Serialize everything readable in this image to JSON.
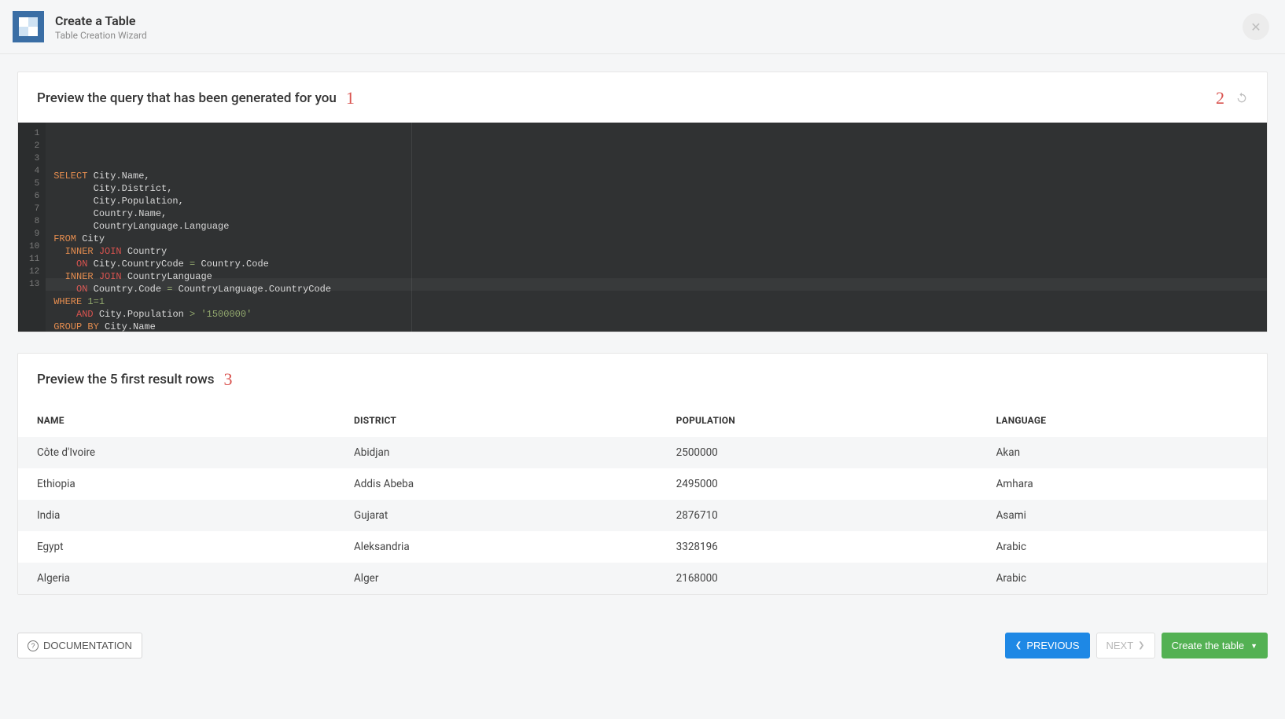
{
  "header": {
    "title": "Create a Table",
    "subtitle": "Table Creation Wizard"
  },
  "queryPanel": {
    "heading": "Preview the query that has been generated for you",
    "callout": "1",
    "refreshCallout": "2",
    "code": {
      "lineCount": 13,
      "tokens": [
        [
          {
            "c": "kw",
            "t": "SELECT"
          },
          {
            "c": "id",
            "t": " City.Name,"
          }
        ],
        [
          {
            "c": "id",
            "t": "       City.District,"
          }
        ],
        [
          {
            "c": "id",
            "t": "       City.Population,"
          }
        ],
        [
          {
            "c": "id",
            "t": "       Country.Name,"
          }
        ],
        [
          {
            "c": "id",
            "t": "       CountryLanguage.Language"
          }
        ],
        [
          {
            "c": "kw",
            "t": "FROM"
          },
          {
            "c": "id",
            "t": " City"
          }
        ],
        [
          {
            "c": "id",
            "t": "  "
          },
          {
            "c": "kw",
            "t": "INNER"
          },
          {
            "c": "id",
            "t": " "
          },
          {
            "c": "kw2",
            "t": "JOIN"
          },
          {
            "c": "id",
            "t": " Country"
          }
        ],
        [
          {
            "c": "id",
            "t": "    "
          },
          {
            "c": "kw2",
            "t": "ON"
          },
          {
            "c": "id",
            "t": " City.CountryCode "
          },
          {
            "c": "op",
            "t": "="
          },
          {
            "c": "id",
            "t": " Country.Code"
          }
        ],
        [
          {
            "c": "id",
            "t": "  "
          },
          {
            "c": "kw",
            "t": "INNER"
          },
          {
            "c": "id",
            "t": " "
          },
          {
            "c": "kw2",
            "t": "JOIN"
          },
          {
            "c": "id",
            "t": " CountryLanguage"
          }
        ],
        [
          {
            "c": "id",
            "t": "    "
          },
          {
            "c": "kw2",
            "t": "ON"
          },
          {
            "c": "id",
            "t": " Country.Code "
          },
          {
            "c": "op",
            "t": "="
          },
          {
            "c": "id",
            "t": " CountryLanguage.CountryCode"
          }
        ],
        [
          {
            "c": "kw",
            "t": "WHERE"
          },
          {
            "c": "id",
            "t": " "
          },
          {
            "c": "num",
            "t": "1"
          },
          {
            "c": "op",
            "t": "="
          },
          {
            "c": "num",
            "t": "1"
          }
        ],
        [
          {
            "c": "id",
            "t": "    "
          },
          {
            "c": "kw2",
            "t": "AND"
          },
          {
            "c": "id",
            "t": " City.Population "
          },
          {
            "c": "op",
            "t": ">"
          },
          {
            "c": "id",
            "t": " "
          },
          {
            "c": "str",
            "t": "'1500000'"
          }
        ],
        [
          {
            "c": "kw",
            "t": "GROUP"
          },
          {
            "c": "id",
            "t": " "
          },
          {
            "c": "kw",
            "t": "BY"
          },
          {
            "c": "id",
            "t": " City.Name"
          }
        ]
      ]
    }
  },
  "resultsPanel": {
    "heading": "Preview the 5 first result rows",
    "callout": "3",
    "columns": [
      "NAME",
      "DISTRICT",
      "POPULATION",
      "LANGUAGE"
    ],
    "rows": [
      [
        "Côte d'Ivoire",
        "Abidjan",
        "2500000",
        "Akan"
      ],
      [
        "Ethiopia",
        "Addis Abeba",
        "2495000",
        "Amhara"
      ],
      [
        "India",
        "Gujarat",
        "2876710",
        "Asami"
      ],
      [
        "Egypt",
        "Aleksandria",
        "3328196",
        "Arabic"
      ],
      [
        "Algeria",
        "Alger",
        "2168000",
        "Arabic"
      ]
    ]
  },
  "footer": {
    "documentation": "DOCUMENTATION",
    "previous": "PREVIOUS",
    "next": "NEXT",
    "create": "Create the table"
  }
}
